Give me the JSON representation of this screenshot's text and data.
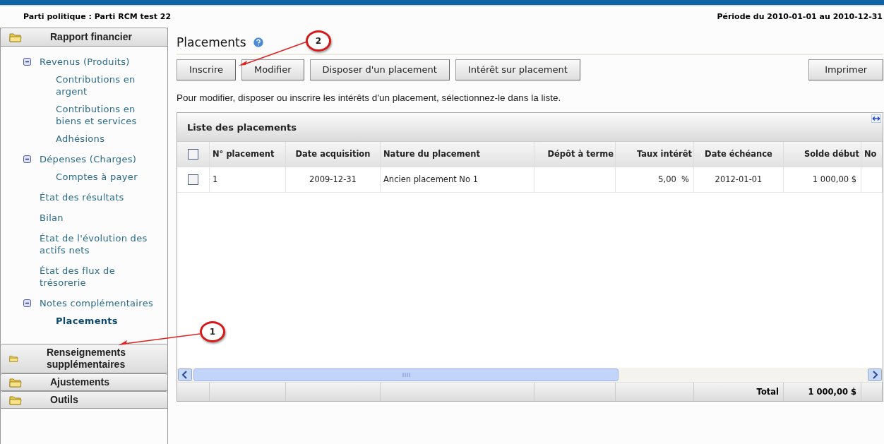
{
  "header": {
    "party": "Parti politique : Parti RCM test 22",
    "period": "Période du 2010-01-01 au 2010-12-31"
  },
  "sidebar": {
    "sections": [
      {
        "title": "Rapport financier",
        "expanded": true,
        "tree": [
          {
            "label": "Revenus (Produits)",
            "expanded": true,
            "selected": false,
            "children": [
              {
                "label": "Contributions en argent",
                "selected": false
              },
              {
                "label": "Contributions en biens et services",
                "selected": false
              },
              {
                "label": "Adhésions",
                "selected": false
              }
            ]
          },
          {
            "label": "Dépenses (Charges)",
            "expanded": true,
            "selected": false,
            "children": [
              {
                "label": "Comptes à payer",
                "selected": false
              }
            ]
          },
          {
            "label": "État des résultats",
            "selected": false
          },
          {
            "label": "Bilan",
            "selected": false
          },
          {
            "label": "État de l'évolution des actifs nets",
            "selected": false
          },
          {
            "label": "État des flux de trésorerie",
            "selected": false
          },
          {
            "label": "Notes complémentaires",
            "expanded": true,
            "selected": false,
            "children": [
              {
                "label": "Placements",
                "selected": true
              }
            ]
          }
        ]
      },
      {
        "title": "Renseignements supplémentaires",
        "expanded": false
      },
      {
        "title": "Ajustements",
        "expanded": false
      },
      {
        "title": "Outils",
        "expanded": false
      }
    ]
  },
  "page": {
    "title": "Placements",
    "buttons": [
      "Inscrire",
      "Modifier",
      "Disposer d'un placement",
      "Intérêt sur placement"
    ],
    "print_button": "Imprimer",
    "instructions": "Pour modifier, disposer ou inscrire les intérêts d'un placement, sélectionnez-le dans la liste.",
    "table": {
      "title": "Liste des placements",
      "select_all_checked": false,
      "columns": [
        "N° placement",
        "Date acquisition",
        "Nature du placement",
        "Dépôt à terme",
        "Taux intérêt",
        "Date échéance",
        "Solde début",
        "No"
      ],
      "rows": [
        {
          "checked": false,
          "cells": [
            "1",
            "2009-12-31",
            "Ancien placement No 1",
            null,
            "5,00  %",
            "2012-01-01",
            "1 000,00 $"
          ]
        }
      ],
      "footer": {
        "label": "Total",
        "amount": "1 000,00 $"
      }
    }
  },
  "callouts": [
    {
      "number": "1"
    },
    {
      "number": "2"
    }
  ]
}
